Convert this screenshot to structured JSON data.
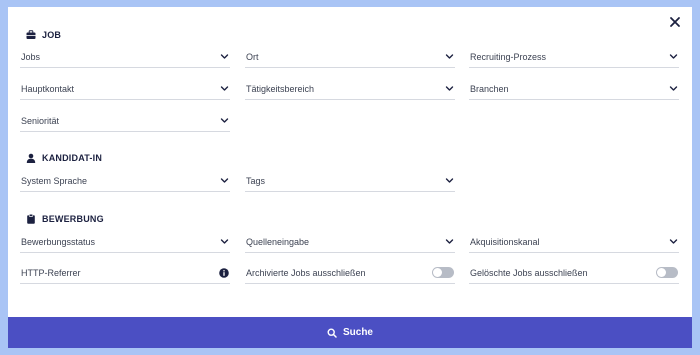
{
  "colors": {
    "accent": "#4b4fc3",
    "background": "#a9c4f5",
    "heading": "#1c2140",
    "toggle_off": "#b7bcc6"
  },
  "icons": {
    "close": "close-icon",
    "job": "briefcase-icon",
    "candidate": "user-icon",
    "application": "clipboard-icon",
    "dropdown": "chevron-down-icon",
    "info": "info-icon",
    "search": "search-icon"
  },
  "sections": {
    "job": {
      "title": "JOB",
      "fields": {
        "jobs": "Jobs",
        "ort": "Ort",
        "recruiting": "Recruiting-Prozess",
        "hauptkontakt": "Hauptkontakt",
        "taetigkeit": "Tätigkeitsbereich",
        "branchen": "Branchen",
        "senioritaet": "Seniorität"
      }
    },
    "candidate": {
      "title": "KANDIDAT-IN",
      "fields": {
        "sprache": "System Sprache",
        "tags": "Tags"
      }
    },
    "application": {
      "title": "BEWERBUNG",
      "fields": {
        "status": "Bewerbungsstatus",
        "quelle": "Quelleneingabe",
        "kanal": "Akquisitionskanal",
        "referrer": "HTTP-Referrer"
      },
      "toggles": {
        "archived_label": "Archivierte Jobs ausschließen",
        "archived_on": false,
        "deleted_label": "Gelöschte Jobs ausschließen",
        "deleted_on": false
      }
    }
  },
  "search_button": {
    "label": "Suche"
  }
}
